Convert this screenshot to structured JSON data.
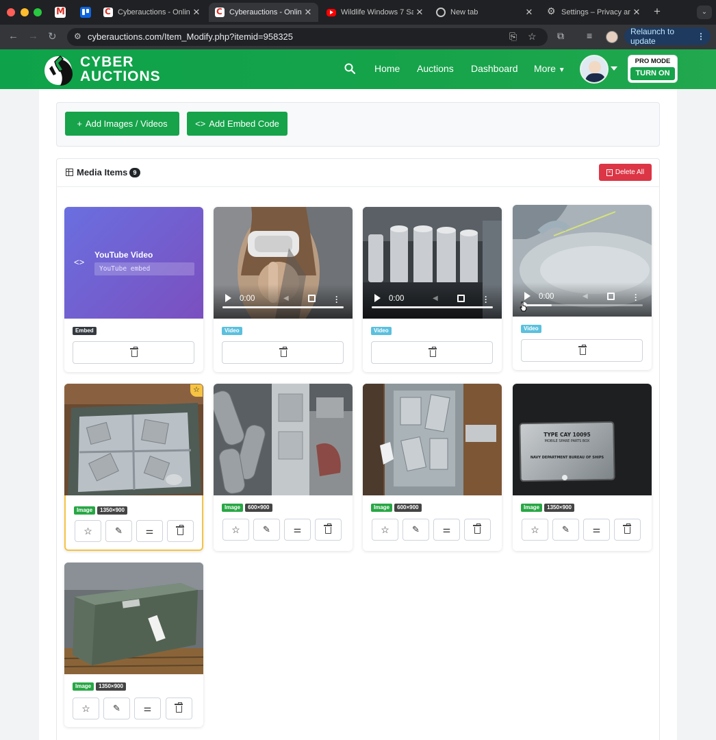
{
  "browser": {
    "tabs": [
      {
        "title": "Cyberauctions - Onlin",
        "favicon": "cyberauctions-icon",
        "active": false
      },
      {
        "title": "Cyberauctions - Onlin",
        "favicon": "cyberauctions-icon",
        "active": true
      },
      {
        "title": "Wildlife Windows 7 Sa",
        "favicon": "youtube-icon",
        "active": false
      },
      {
        "title": "New tab",
        "favicon": "chrome-icon",
        "active": false
      },
      {
        "title": "Settings – Privacy and",
        "favicon": "settings-gear-icon",
        "active": false
      }
    ],
    "url": "cyberauctions.com/Item_Modify.php?itemid=958325",
    "relaunch_label": "Relaunch to update"
  },
  "site": {
    "logo": {
      "line1": "CYBER",
      "line2": "AUCTIONS"
    },
    "nav": {
      "home": "Home",
      "auctions": "Auctions",
      "dashboard": "Dashboard",
      "more": "More"
    },
    "pro_mode": {
      "title": "PRO MODE",
      "button": "TURN ON"
    },
    "brand_color": "#16a34a"
  },
  "upload": {
    "add_media_label": "Add Images / Videos",
    "add_embed_label": "Add Embed Code"
  },
  "media": {
    "title": "Media Items",
    "count": "9",
    "delete_all_label": "Delete All",
    "items": [
      {
        "type": "Embed",
        "embed_title": "YouTube Video",
        "embed_code": "YouTube embed"
      },
      {
        "type": "Video",
        "time": "0:00"
      },
      {
        "type": "Video",
        "time": "0:00"
      },
      {
        "type": "Video",
        "time": "0:00"
      },
      {
        "type": "Image",
        "dimensions": "1350×900",
        "featured": true
      },
      {
        "type": "Image",
        "dimensions": "600×900"
      },
      {
        "type": "Image",
        "dimensions": "600×900"
      },
      {
        "type": "Image",
        "dimensions": "1350×900",
        "plate_text": [
          "TYPE CAY 10095",
          "MOBILE SPARE PARTS BOX",
          "NAVY DEPARTMENT BUREAU OF SHIPS"
        ]
      },
      {
        "type": "Image",
        "dimensions": "1350×900"
      }
    ]
  }
}
